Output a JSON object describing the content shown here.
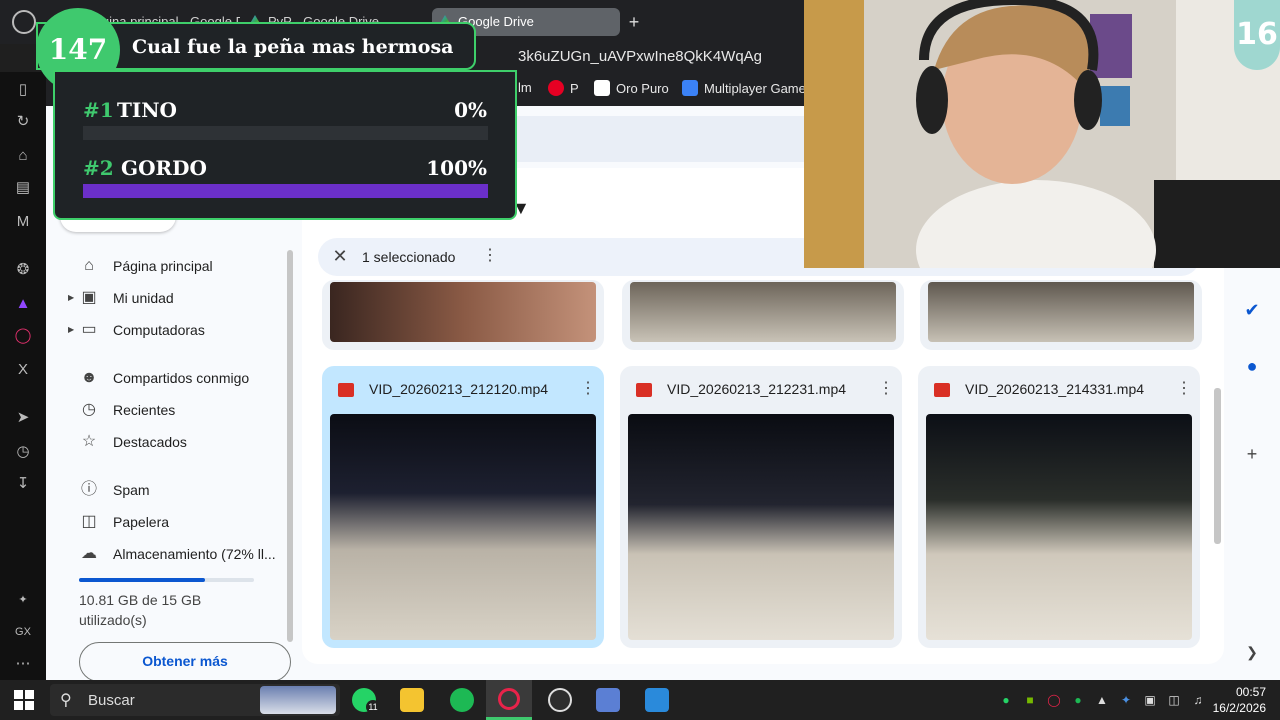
{
  "browser": {
    "tabs": [
      {
        "label": "Página principal - Google Drive"
      },
      {
        "label": "PvP - Google Drive"
      },
      {
        "label": "Google Drive"
      }
    ],
    "new_tab": "+",
    "url": "3k6uZUGn_uAVPxwIne8QkK4WqAg",
    "bookmarks": [
      {
        "label": "lm"
      },
      {
        "label": "P"
      },
      {
        "label": "Oro Puro"
      },
      {
        "label": "Multiplayer Game"
      }
    ]
  },
  "poll": {
    "number": "147",
    "question": "Cual fue la peña mas hermosa",
    "options": [
      {
        "rank": "#1",
        "name": "TINO",
        "percent_label": "0%",
        "percent": 0
      },
      {
        "rank": "#2",
        "name": "GORDO",
        "percent_label": "100%",
        "percent": 100
      }
    ],
    "bar_color": "#6b2fc9",
    "accent": "#3fc96e"
  },
  "webcam_badge": "16",
  "drive": {
    "nav": [
      {
        "label": "Página principal",
        "icon": "home-icon"
      },
      {
        "label": "Mi unidad",
        "icon": "drive-icon"
      },
      {
        "label": "Computadoras",
        "icon": "computer-icon"
      },
      {
        "label": "Compartidos conmigo",
        "icon": "people-icon"
      },
      {
        "label": "Recientes",
        "icon": "clock-icon"
      },
      {
        "label": "Destacados",
        "icon": "star-icon"
      },
      {
        "label": "Spam",
        "icon": "spam-icon"
      },
      {
        "label": "Papelera",
        "icon": "trash-icon"
      },
      {
        "label": "Almacenamiento (72% ll...",
        "icon": "cloud-icon"
      }
    ],
    "storage": {
      "used_text": "10.81 GB de 15 GB utilizado(s)",
      "fraction": 0.72
    },
    "get_more": "Obtener más",
    "selection": {
      "count_text": "1 seleccionado"
    },
    "files": [
      {
        "name": "VID_20260213_212120.mp4",
        "selected": true
      },
      {
        "name": "VID_20260213_212231.mp4",
        "selected": false
      },
      {
        "name": "VID_20260213_214331.mp4",
        "selected": false
      }
    ]
  },
  "taskbar": {
    "search_placeholder": "Buscar",
    "whatsapp_badge": "11",
    "time": "00:57",
    "date": "16/2/2026"
  },
  "colors": {
    "drive_blue": "#0b57d0",
    "selected_card": "#c2e7ff"
  }
}
